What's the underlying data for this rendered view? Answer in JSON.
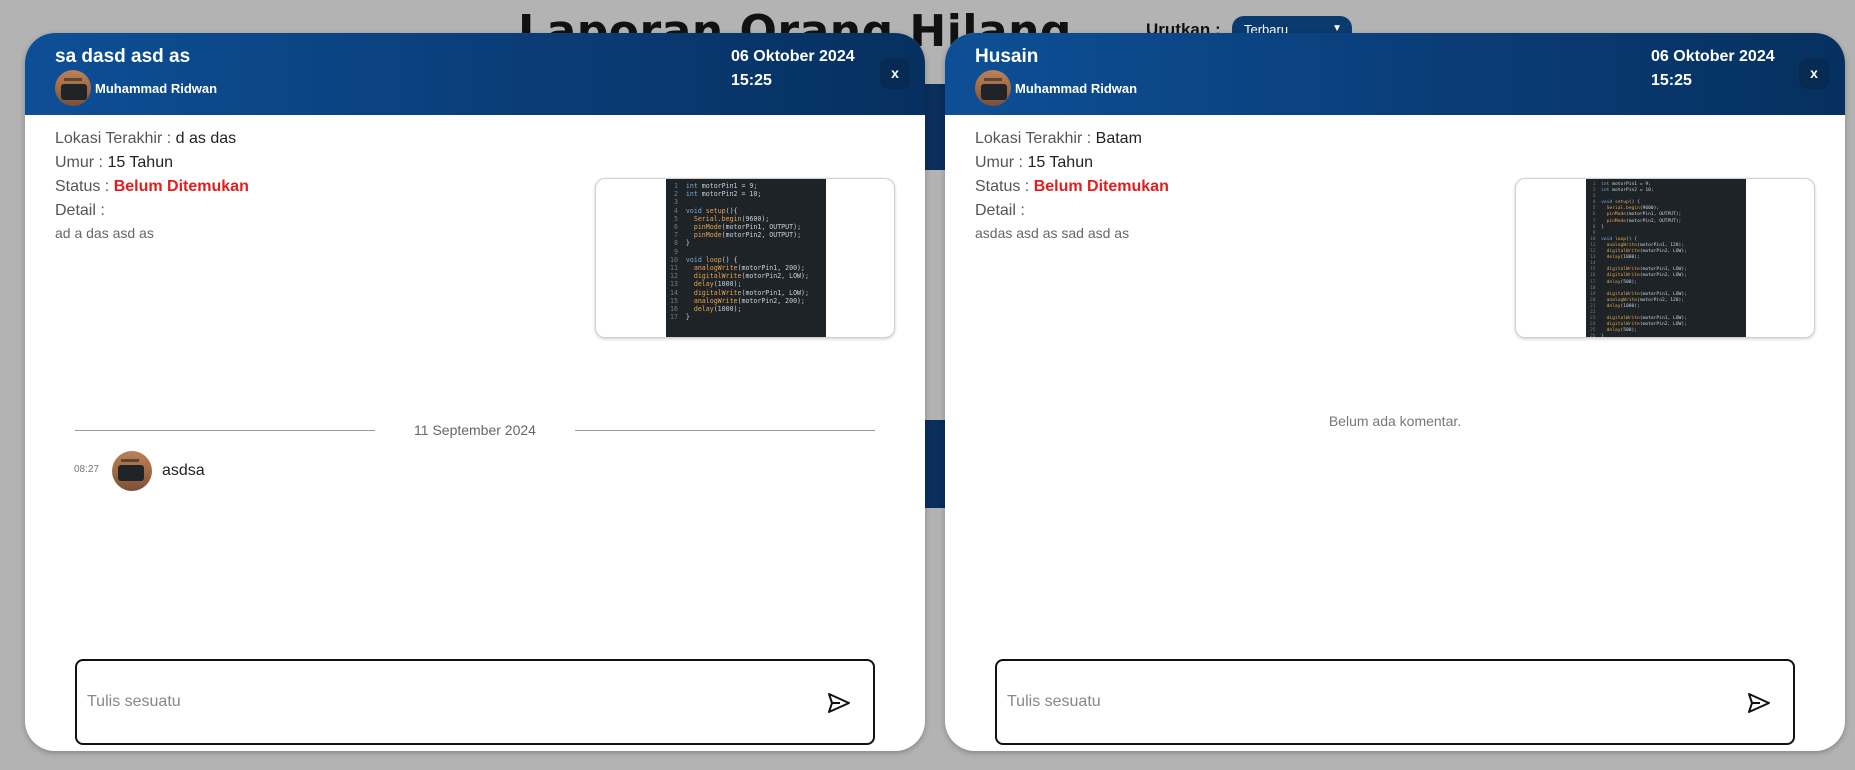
{
  "background": {
    "title": "Laporan Orang Hilang",
    "sort_label": "Urutkan :",
    "sort_value": "Terbaru"
  },
  "modals": [
    {
      "title": "sa dasd asd as",
      "author": "Muhammad Ridwan",
      "date": "06 Oktober 2024",
      "time": "15:25",
      "close_label": "x",
      "location_label": "Lokasi Terakhir :",
      "location": "d as das",
      "age_label": "Umur :",
      "age": "15 Tahun",
      "status_label": "Status :",
      "status": "Belum Ditemukan",
      "status_color": "#e01e1e",
      "detail_label": "Detail :",
      "detail": "ad a das asd as",
      "comment_date": "11 September 2024",
      "comments": [
        {
          "time": "08:27",
          "text": "asdsa"
        }
      ],
      "input_placeholder": "Tulis sesuatu"
    },
    {
      "title": "Husain",
      "author": "Muhammad Ridwan",
      "date": "06 Oktober 2024",
      "time": "15:25",
      "close_label": "x",
      "location_label": "Lokasi Terakhir :",
      "location": "Batam",
      "age_label": "Umur :",
      "age": "15 Tahun",
      "status_label": "Status :",
      "status": "Belum Ditemukan",
      "status_color": "#e01e1e",
      "detail_label": "Detail :",
      "detail": "asdas asd as sad asd as",
      "empty_comments": "Belum ada komentar.",
      "input_placeholder": "Tulis sesuatu"
    }
  ],
  "colors": {
    "header_start": "#0d4f96",
    "header_end": "#06305f",
    "backdrop": "#b3b3b3"
  }
}
